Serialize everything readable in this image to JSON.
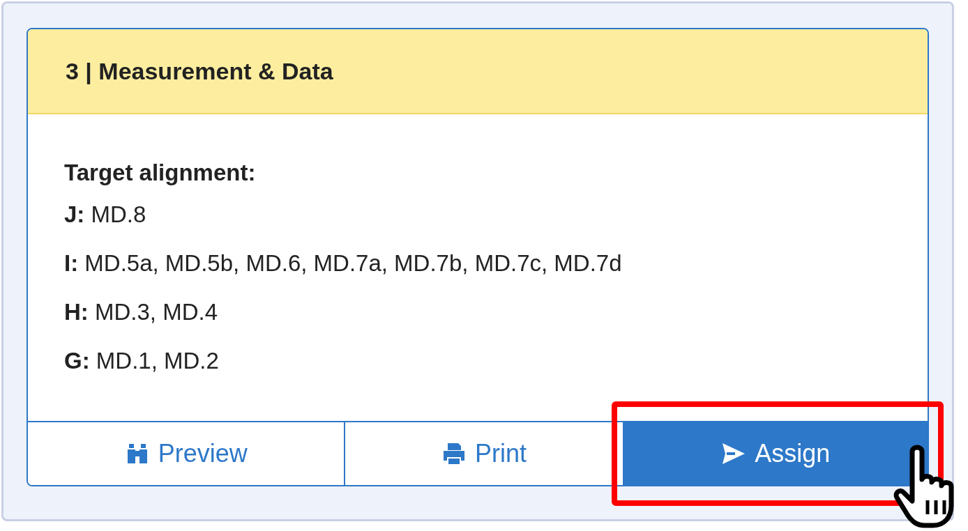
{
  "card": {
    "title": "3 | Measurement & Data",
    "heading": "Target alignment:",
    "lines": [
      {
        "grade": "J:",
        "standards": "MD.8"
      },
      {
        "grade": "I:",
        "standards": "MD.5a, MD.5b, MD.6, MD.7a, MD.7b, MD.7c, MD.7d"
      },
      {
        "grade": "H:",
        "standards": "MD.3, MD.4"
      },
      {
        "grade": "G:",
        "standards": "MD.1, MD.2"
      }
    ],
    "buttons": [
      {
        "label": "Preview",
        "kind": "preview",
        "primary": false,
        "highlighted": false
      },
      {
        "label": "Print",
        "kind": "print",
        "primary": false,
        "highlighted": false
      },
      {
        "label": "Assign",
        "kind": "assign",
        "primary": true,
        "highlighted": true
      }
    ]
  }
}
